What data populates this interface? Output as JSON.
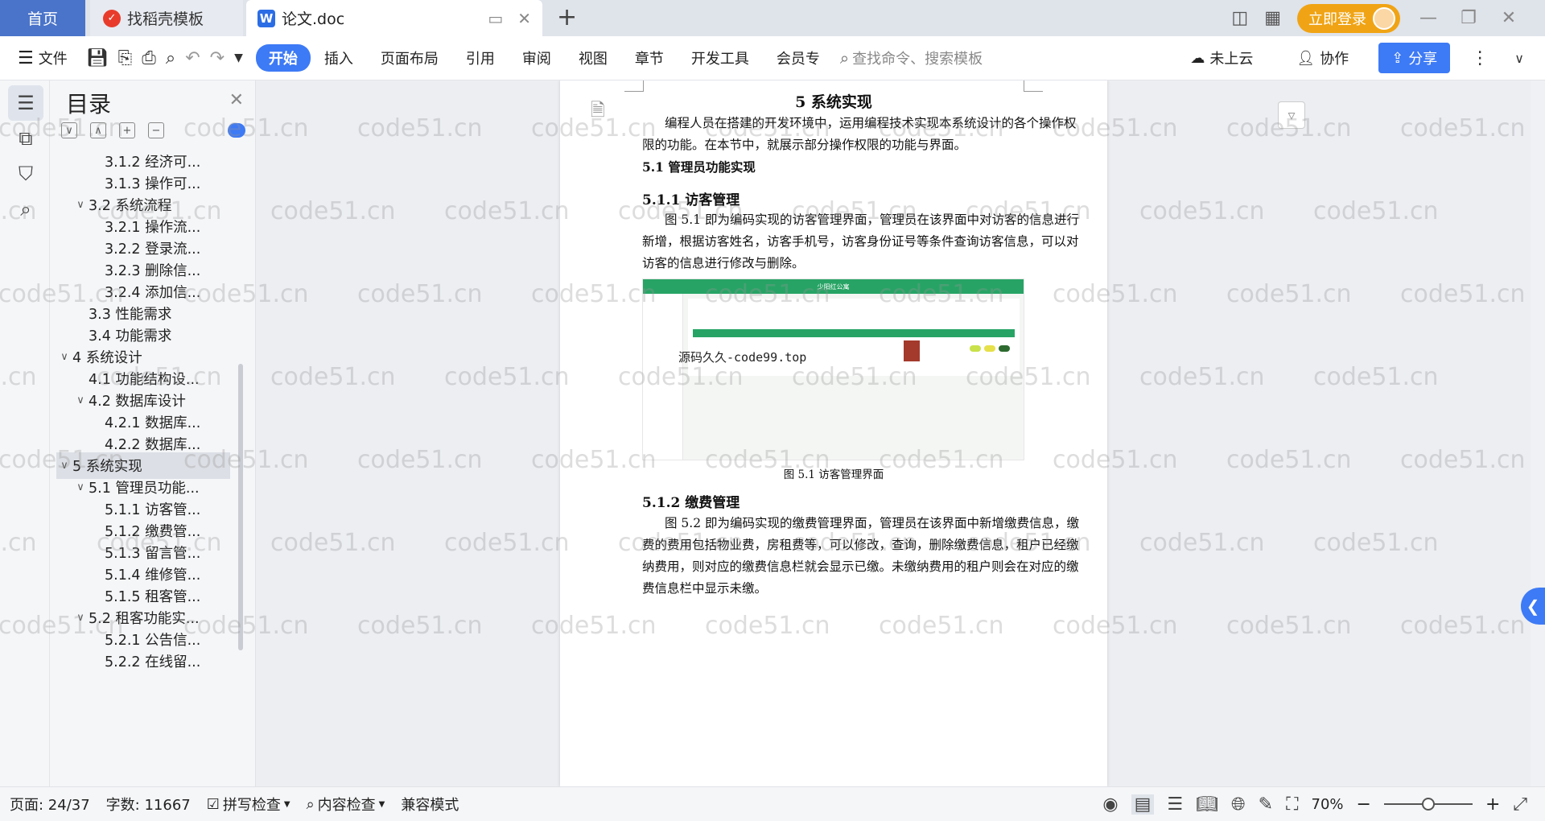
{
  "tabs": {
    "home": "首页",
    "templates": "找稻壳模板",
    "doc": "论文.doc",
    "new_tab": "+"
  },
  "topbar": {
    "login": "立即登录"
  },
  "toolbar": {
    "file": "文件",
    "menus": [
      "开始",
      "插入",
      "页面布局",
      "引用",
      "审阅",
      "视图",
      "章节",
      "开发工具",
      "会员专"
    ],
    "search_placeholder": "查找命令、搜索模板",
    "cloud": "未上云",
    "collab": "协作",
    "share": "分享"
  },
  "toc": {
    "title": "目录",
    "items": [
      {
        "label": "3.1.2  经济可...",
        "level": 3,
        "caret": ""
      },
      {
        "label": "3.1.3  操作可...",
        "level": 3,
        "caret": ""
      },
      {
        "label": "3.2  系统流程",
        "level": 2,
        "caret": "v"
      },
      {
        "label": "3.2.1  操作流...",
        "level": 3,
        "caret": ""
      },
      {
        "label": "3.2.2  登录流...",
        "level": 3,
        "caret": ""
      },
      {
        "label": "3.2.3  删除信...",
        "level": 3,
        "caret": ""
      },
      {
        "label": "3.2.4  添加信...",
        "level": 3,
        "caret": ""
      },
      {
        "label": "3.3  性能需求",
        "level": 2,
        "caret": ""
      },
      {
        "label": "3.4  功能需求",
        "level": 2,
        "caret": ""
      },
      {
        "label": "4  系统设计",
        "level": 1,
        "caret": "v"
      },
      {
        "label": "4.1  功能结构设...",
        "level": 2,
        "caret": ""
      },
      {
        "label": "4.2  数据库设计",
        "level": 2,
        "caret": "v"
      },
      {
        "label": "4.2.1  数据库...",
        "level": 3,
        "caret": ""
      },
      {
        "label": "4.2.2  数据库...",
        "level": 3,
        "caret": ""
      },
      {
        "label": "5  系统实现",
        "level": 1,
        "caret": "v",
        "selected": true
      },
      {
        "label": "5.1  管理员功能...",
        "level": 2,
        "caret": "v"
      },
      {
        "label": "5.1.1  访客管...",
        "level": 3,
        "caret": ""
      },
      {
        "label": "5.1.2  缴费管...",
        "level": 3,
        "caret": ""
      },
      {
        "label": "5.1.3  留言管...",
        "level": 3,
        "caret": ""
      },
      {
        "label": "5.1.4  维修管...",
        "level": 3,
        "caret": ""
      },
      {
        "label": "5.1.5  租客管...",
        "level": 3,
        "caret": ""
      },
      {
        "label": "5.2  租客功能实...",
        "level": 2,
        "caret": "v"
      },
      {
        "label": "5.2.1  公告信...",
        "level": 3,
        "caret": ""
      },
      {
        "label": "5.2.2  在线留...",
        "level": 3,
        "caret": ""
      }
    ]
  },
  "doc": {
    "chapter_title": "5  系统实现",
    "intro_line1": "编程人员在搭建的开发环境中，运用编程技术实现本系统设计的各个操作权",
    "intro_line2": "限的功能。在本节中，就展示部分操作权限的功能与界面。",
    "sec_5_1": "5.1  管理员功能实现",
    "sec_5_1_1": "5.1.1  访客管理",
    "p511_1": "图 5.1  即为编码实现的访客管理界面，管理员在该界面中对访客的信息进行",
    "p511_2": "新增，根据访客姓名，访客手机号，访客身份证号等条件查询访客信息，可以对",
    "p511_3": "访客的信息进行修改与删除。",
    "figure_header": "少阳红公寓",
    "figure_watermark": "源码久久-code99.top",
    "figure_caption": "图 5.1  访客管理界面",
    "sec_5_1_2": "5.1.2  缴费管理",
    "p512_1": "图 5.2  即为编码实现的缴费管理界面，管理员在该界面中新增缴费信息，缴",
    "p512_2": "费的费用包括物业费，房租费等，可以修改，查询，删除缴费信息，租户已经缴",
    "p512_3": "纳费用，则对应的缴费信息栏就会显示已缴。未缴纳费用的租户则会在对应的缴",
    "p512_4": "费信息栏中显示未缴。"
  },
  "status": {
    "page": "页面: 24/37",
    "words": "字数: 11667",
    "spell": "拼写检查",
    "content_check": "内容检查",
    "compat": "兼容模式",
    "zoom": "70%",
    "zoom_fraction": 0.5
  },
  "watermark_text": "code51.cn",
  "colors": {
    "accent": "#3d7af5",
    "login": "#f0a415",
    "figure_green": "#27a465",
    "home_tab": "#4a74c9"
  }
}
